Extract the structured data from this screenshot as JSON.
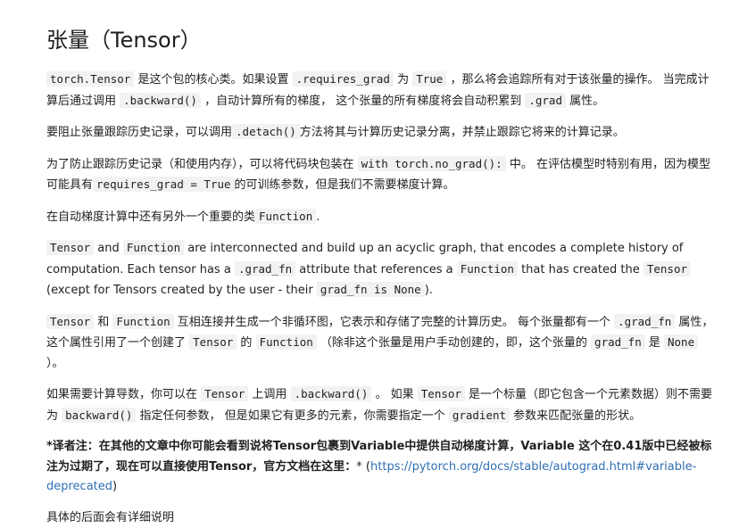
{
  "title": "张量（Tensor）",
  "p1": {
    "c1": "torch.Tensor",
    "t1": " 是这个包的核心类。如果设置 ",
    "c2": ".requires_grad",
    "t2": " 为 ",
    "c3": "True",
    "t3": " ，那么将会追踪所有对于该张量的操作。 当完成计算后通过调用 ",
    "c4": ".backward()",
    "t4": " ，自动计算所有的梯度， 这个张量的所有梯度将会自动积累到 ",
    "c5": ".grad",
    "t5": " 属性。"
  },
  "p2": {
    "t1": "要阻止张量跟踪历史记录，可以调用",
    "c1": ".detach()",
    "t2": "方法将其与计算历史记录分离，并禁止跟踪它将来的计算记录。"
  },
  "p3": {
    "t1": "为了防止跟踪历史记录（和使用内存），可以将代码块包装在 ",
    "c1": "with torch.no_grad():",
    "t2": " 中。 在评估模型时特别有用，因为模型可能具有",
    "c2": "requires_grad = True",
    "t3": "的可训练参数，但是我们不需要梯度计算。"
  },
  "p4": {
    "t1": "在自动梯度计算中还有另外一个重要的类",
    "c1": "Function",
    "t2": "."
  },
  "p5": {
    "c1": "Tensor",
    "t1": " and ",
    "c2": "Function",
    "t2": " are interconnected and build up an acyclic graph, that encodes a complete history of computation. Each tensor has a ",
    "c3": ".grad_fn",
    "t3": " attribute that references a ",
    "c4": "Function",
    "t4": " that has created the ",
    "c5": "Tensor",
    "t5": " (except for Tensors created by the user - their ",
    "c6": "grad_fn is None",
    "t6": ")."
  },
  "p6": {
    "c1": "Tensor",
    "t1": " 和 ",
    "c2": "Function",
    "t2": " 互相连接并生成一个非循环图，它表示和存储了完整的计算历史。 每个张量都有一个 ",
    "c3": ".grad_fn",
    "t3": " 属性，这个属性引用了一个创建了 ",
    "c4": "Tensor",
    "t4": " 的 ",
    "c5": "Function",
    "t5": " （除非这个张量是用户手动创建的，即，这个张量的 ",
    "c6": "grad_fn",
    "t6": " 是 ",
    "c7": "None",
    "t7": " ）。"
  },
  "p7": {
    "t1": "如果需要计算导数，你可以在 ",
    "c1": "Tensor",
    "t2": " 上调用 ",
    "c2": ".backward()",
    "t3": " 。 如果 ",
    "c3": "Tensor",
    "t4": " 是一个标量（即它包含一个元素数据）则不需要为 ",
    "c4": "backward()",
    "t5": " 指定任何参数， 但是如果它有更多的元素，你需要指定一个 ",
    "c5": "gradient",
    "t6": " 参数来匹配张量的形状。"
  },
  "note": {
    "bold": "*译者注：在其他的文章中你可能会看到说将Tensor包裹到Variable中提供自动梯度计算，Variable 这个在0.41版中已经被标注为过期了，现在可以直接使用Tensor，官方文档在这里：",
    "t1": "* (",
    "link": "https://pytorch.org/docs/stable/autograd.html#variable-deprecated",
    "t2": ")"
  },
  "p8": "具体的后面会有详细说明"
}
